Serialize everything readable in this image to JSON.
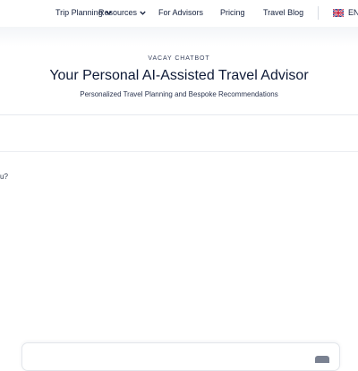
{
  "nav": {
    "items": [
      {
        "label": "Trip Planning",
        "dropdown": true
      },
      {
        "label": "Resources",
        "dropdown": true
      },
      {
        "label": "For Advisors",
        "dropdown": false
      },
      {
        "label": "Pricing",
        "dropdown": false
      },
      {
        "label": "Travel Blog",
        "dropdown": false
      }
    ],
    "language": "EN",
    "flag_icon": "uk-flag-icon"
  },
  "hero": {
    "eyebrow": "VACAY CHATBOT",
    "title": "Your Personal AI-Assisted Travel Advisor",
    "subtitle": "Personalized Travel Planning and Bespoke Recommendations"
  },
  "chat": {
    "visible_message_fragment": "u?"
  },
  "colors": {
    "text_dark": "#0f1b38",
    "send_button": "#7a8191"
  }
}
